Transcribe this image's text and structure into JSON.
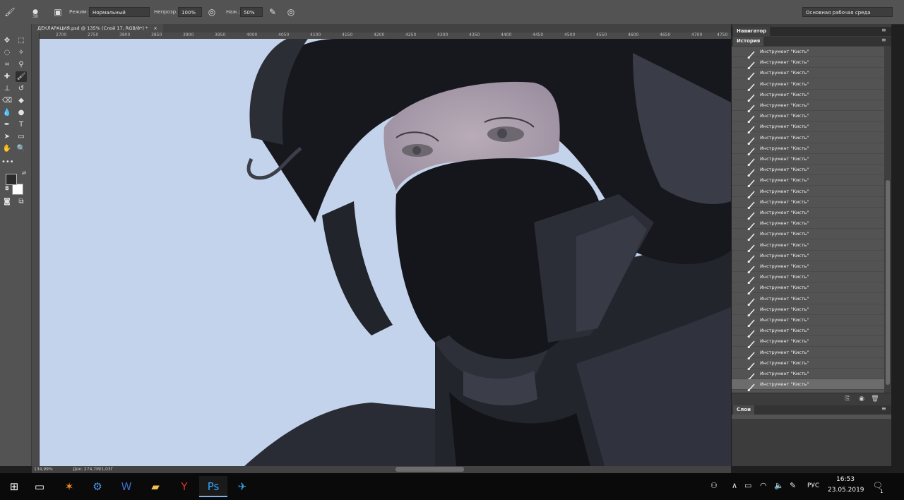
{
  "options_bar": {
    "brush_size": "38",
    "mode_label": "Режим:",
    "mode_value": "Нормальный",
    "opacity_label": "Непрозр.:",
    "opacity_value": "100%",
    "pressure_label": "Наж.:",
    "pressure_value": "50%",
    "workspace": "Основная рабочая среда"
  },
  "document": {
    "tab_title": "ДЕКЛАРАЦИЯ.psd @ 135% (Слой 17, RGB/8*) *",
    "ruler_ticks": [
      "2700",
      "2750",
      "3800",
      "3850",
      "3900",
      "3950",
      "4000",
      "4050",
      "4100",
      "4150",
      "4200",
      "4250",
      "4300",
      "4350",
      "4400",
      "4450",
      "4500",
      "4550",
      "4600",
      "4650",
      "4700",
      "4750"
    ]
  },
  "status_bar": {
    "zoom": "134,99%",
    "doc_size": "Док: 274,7M/1,03Г"
  },
  "panels": {
    "navigator_tab": "Навигатор",
    "history_tab": "История",
    "layers_tab": "Слои",
    "history_items": [
      "Инструмент \"Кисть\"",
      "Инструмент \"Кисть\"",
      "Инструмент \"Кисть\"",
      "Инструмент \"Кисть\"",
      "Инструмент \"Кисть\"",
      "Инструмент \"Кисть\"",
      "Инструмент \"Кисть\"",
      "Инструмент \"Кисть\"",
      "Инструмент \"Кисть\"",
      "Инструмент \"Кисть\"",
      "Инструмент \"Кисть\"",
      "Инструмент \"Кисть\"",
      "Инструмент \"Кисть\"",
      "Инструмент \"Кисть\"",
      "Инструмент \"Кисть\"",
      "Инструмент \"Кисть\"",
      "Инструмент \"Кисть\"",
      "Инструмент \"Кисть\"",
      "Инструмент \"Кисть\"",
      "Инструмент \"Кисть\"",
      "Инструмент \"Кисть\"",
      "Инструмент \"Кисть\"",
      "Инструмент \"Кисть\"",
      "Инструмент \"Кисть\"",
      "Инструмент \"Кисть\"",
      "Инструмент \"Кисть\"",
      "Инструмент \"Кисть\"",
      "Инструмент \"Кисть\"",
      "Инструмент \"Кисть\"",
      "Инструмент \"Кисть\"",
      "Инструмент \"Кисть\"",
      "Инструмент \"Кисть\""
    ]
  },
  "taskbar": {
    "apps": [
      "windows-start",
      "task-view",
      "avast",
      "settings",
      "word",
      "file-explorer",
      "yandex-browser",
      "photoshop",
      "telegram"
    ],
    "language": "РУС",
    "time": "16:53",
    "date": "23.05.2019",
    "notification_count": "1"
  },
  "colors": {
    "canvas_background": "#c4d3ec",
    "panel_dark": "#3c3c3c",
    "panel_mid": "#535353",
    "foreground_swatch": "#2b2b2b",
    "background_swatch": "#ffffff"
  }
}
